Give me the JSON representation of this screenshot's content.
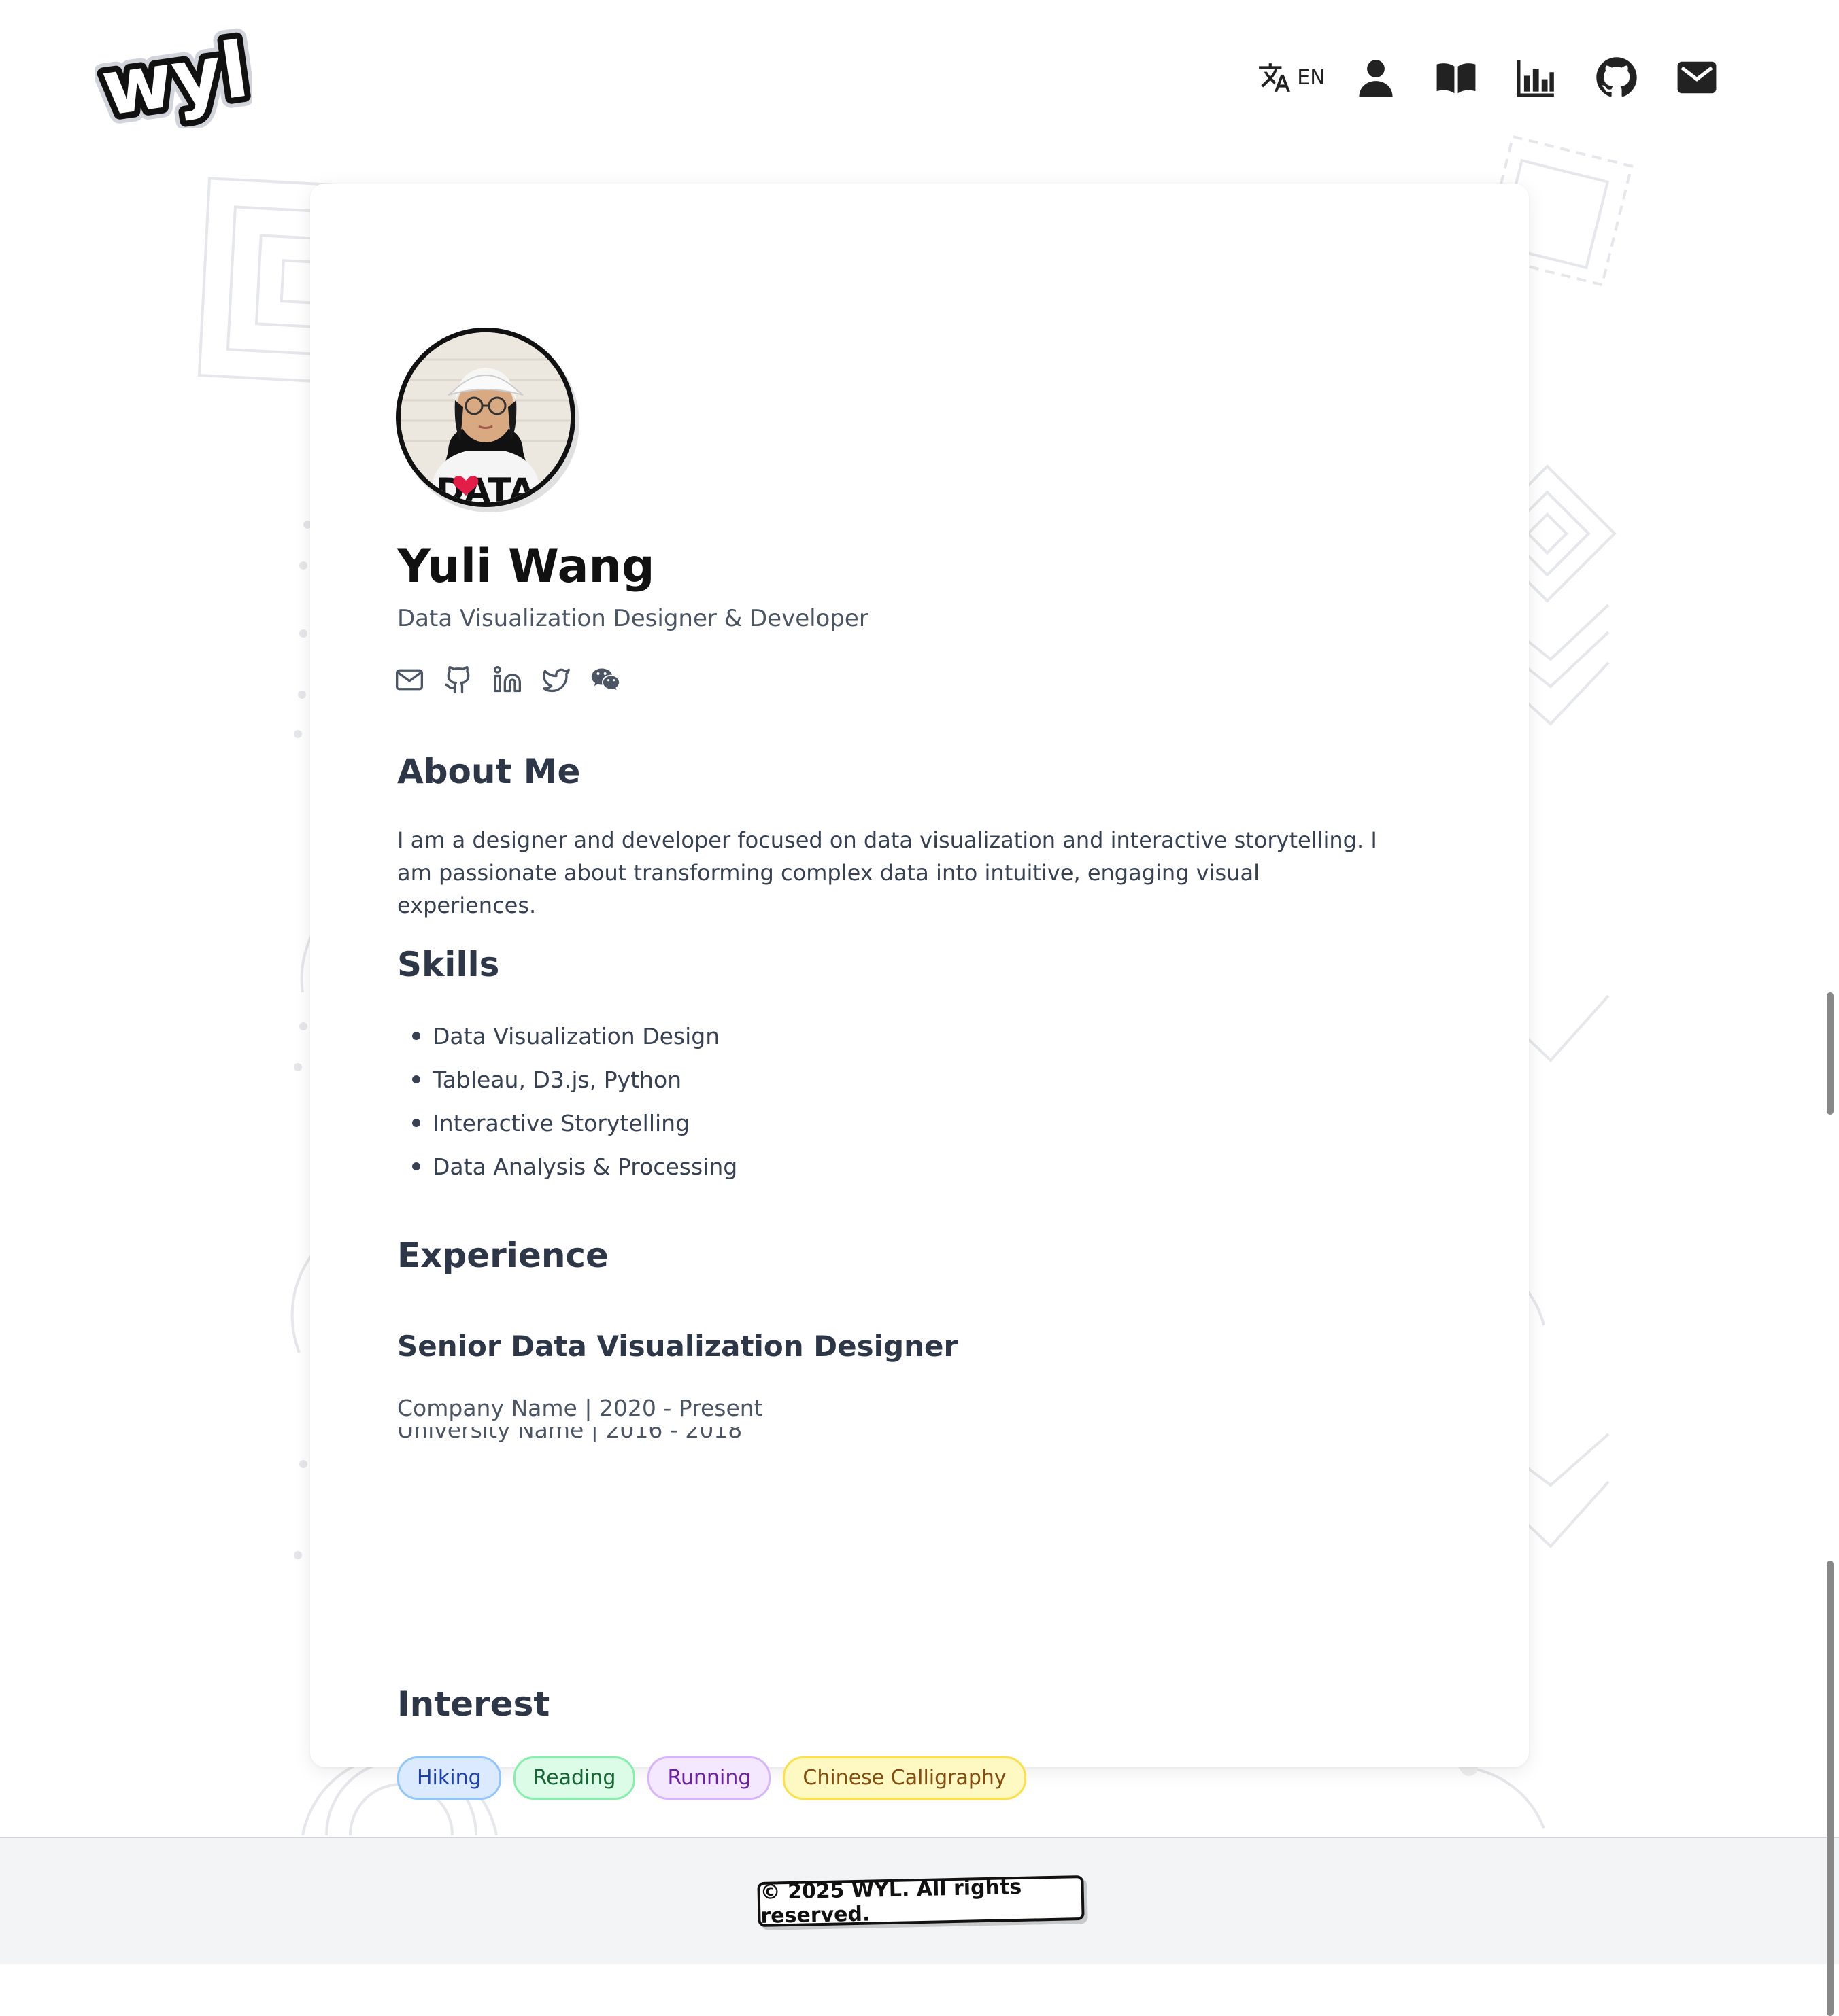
{
  "header": {
    "logo_text": "wyl",
    "language_code": "EN",
    "nav_icons": [
      "translate-icon",
      "user-icon",
      "book-icon",
      "chart-icon",
      "github-icon",
      "mail-icon"
    ]
  },
  "profile": {
    "avatar_shirt_text": "DATA",
    "name": "Yuli Wang",
    "title": "Data Visualization Designer & Developer",
    "social_icons": [
      "mail-icon",
      "github-icon",
      "linkedin-icon",
      "twitter-icon",
      "wechat-icon"
    ]
  },
  "about": {
    "heading": "About Me",
    "text": "I am a designer and developer focused on data visualization and interactive storytelling. I am passionate about transforming complex data into intuitive, engaging visual experiences."
  },
  "skills": {
    "heading": "Skills",
    "items": [
      "Data Visualization Design",
      "Tableau, D3.js, Python",
      "Interactive Storytelling",
      "Data Analysis & Processing"
    ]
  },
  "experience": {
    "heading": "Experience",
    "job_title": "Senior Data Visualization Designer",
    "job_meta": "Company Name | 2020 - Present",
    "overlapped_text": "University Name | 2016 - 2018"
  },
  "interest": {
    "heading": "Interest",
    "tags": [
      {
        "label": "Hiking",
        "bg": "#dbeafe",
        "border": "#93c5fd",
        "color": "#1e40af"
      },
      {
        "label": "Reading",
        "bg": "#dcfce7",
        "border": "#86efac",
        "color": "#166534"
      },
      {
        "label": "Running",
        "bg": "#f3e8ff",
        "border": "#d8b4fe",
        "color": "#6b21a8"
      },
      {
        "label": "Chinese Calligraphy",
        "bg": "#fef9c3",
        "border": "#fde047",
        "color": "#854d0e"
      }
    ]
  },
  "footer": {
    "copyright": "© 2025 WYL. All rights reserved."
  }
}
